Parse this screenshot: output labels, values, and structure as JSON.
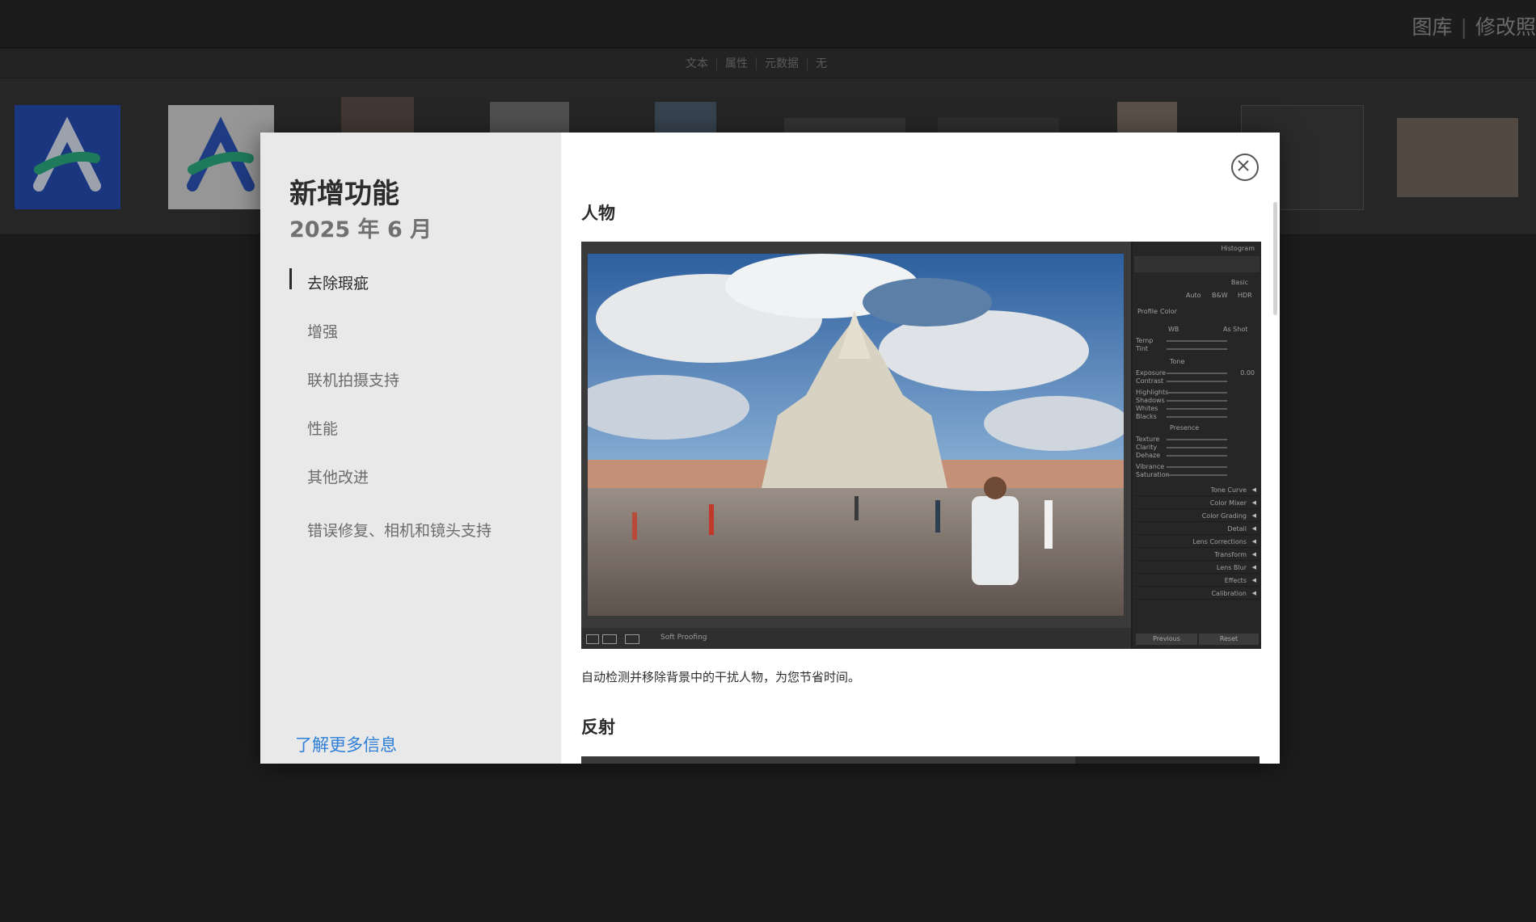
{
  "app": {
    "modules": [
      "图库",
      "修改照"
    ],
    "filter_bar": [
      "文本",
      "属性",
      "元数据",
      "无"
    ]
  },
  "dialog": {
    "title": "新增功能",
    "date": "2025 年 6 月",
    "nav": [
      {
        "label": "去除瑕疵",
        "active": true
      },
      {
        "label": "增强"
      },
      {
        "label": "联机拍摄支持"
      },
      {
        "label": "性能"
      },
      {
        "label": "其他改进"
      },
      {
        "label": "错误修复、相机和镜头支持"
      }
    ],
    "learn_more": "了解更多信息",
    "close_icon": "close-icon",
    "sections": [
      {
        "heading": "人物",
        "description": "自动检测并移除背景中的干扰人物，为您节省时间。"
      },
      {
        "heading": "反射"
      }
    ]
  },
  "screenshot_panel": {
    "histogram": "Histogram",
    "basic": "Basic",
    "auto": "Auto",
    "bw": "B&W",
    "hdr": "HDR",
    "profile": "Profile",
    "profile_value": "Color",
    "wb": "WB",
    "wb_value": "As Shot",
    "temp": "Temp",
    "tint": "Tint",
    "tone": "Tone",
    "exposure": "Exposure",
    "exposure_value": "0.00",
    "contrast": "Contrast",
    "highlights": "Highlights",
    "shadows": "Shadows",
    "whites": "Whites",
    "blacks": "Blacks",
    "presence": "Presence",
    "texture": "Texture",
    "clarity": "Clarity",
    "dehaze": "Dehaze",
    "vibrance": "Vibrance",
    "saturation": "Saturation",
    "sections": [
      "Tone Curve",
      "Color Mixer",
      "Color Grading",
      "Detail",
      "Lens Corrections",
      "Transform",
      "Lens Blur",
      "Effects",
      "Calibration"
    ],
    "previous": "Previous",
    "reset": "Reset",
    "soft_proofing": "Soft Proofing"
  },
  "colors": {
    "accent_link": "#2d7fd8",
    "dialog_left_bg": "#e9e9e9",
    "app_bg": "#262626"
  }
}
